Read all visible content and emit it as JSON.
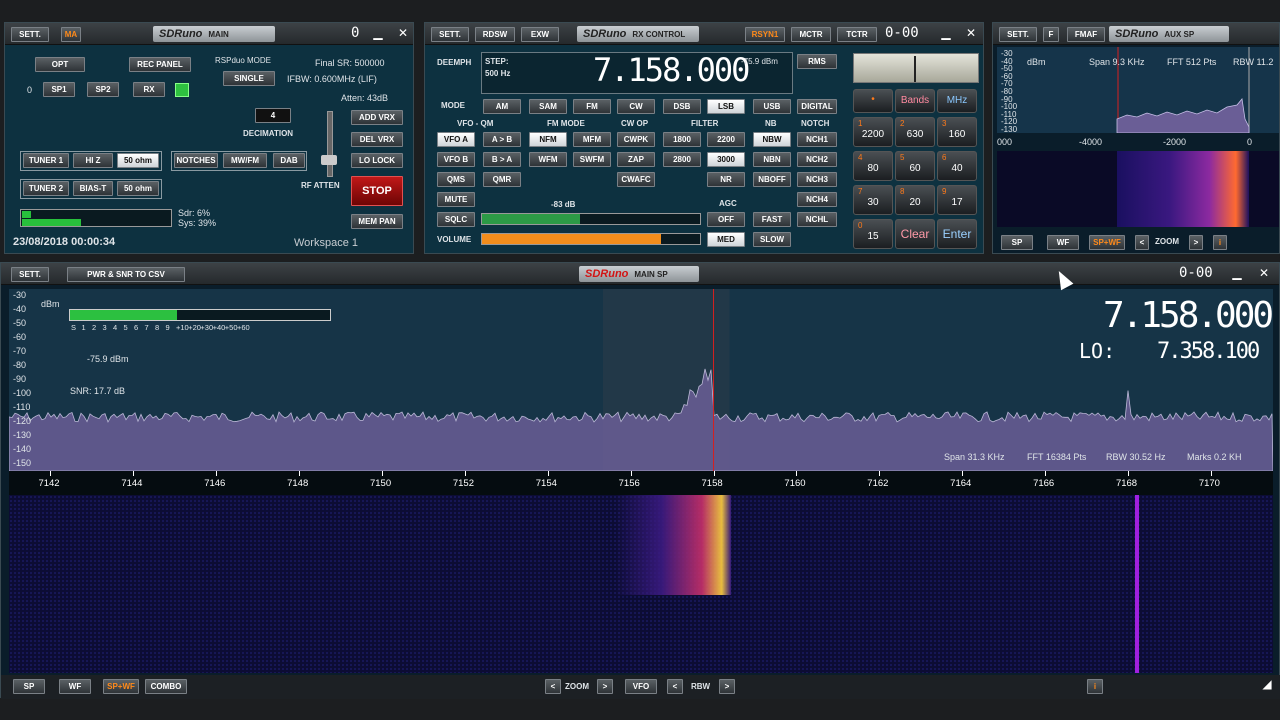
{
  "main": {
    "sett": "SETT.",
    "ma": "MA",
    "logo": "SDRuno",
    "title": "MAIN",
    "counter": "0",
    "opt": "OPT",
    "rec_panel": "REC PANEL",
    "rsp_mode_label": "RSPduo MODE",
    "single": "SINGLE",
    "final_sr": "Final SR: 500000",
    "ifbw": "IFBW: 0.600MHz (LIF)",
    "atten": "Atten: 43dB",
    "num0": "0",
    "sp1": "SP1",
    "sp2": "SP2",
    "rx": "RX",
    "decimation_val": "4",
    "decimation_label": "DECIMATION",
    "add_vrx": "ADD VRX",
    "del_vrx": "DEL VRX",
    "lo_lock": "LO LOCK",
    "rf_atten": "RF ATTEN",
    "stop": "STOP",
    "mem_pan": "MEM PAN",
    "tuner1": "TUNER 1",
    "hiz": "HI Z",
    "ohm1": "50 ohm",
    "notches": "NOTCHES",
    "mwfm": "MW/FM",
    "dab": "DAB",
    "tuner2": "TUNER 2",
    "biast": "BIAS-T",
    "ohm2": "50 ohm",
    "sdr": "Sdr: 6%",
    "sys": "Sys: 39%",
    "sdr_load": 0.06,
    "sys_load": 0.39,
    "datetime": "23/08/2018 00:00:34",
    "workspace": "Workspace 1"
  },
  "rx": {
    "sett": "SETT.",
    "rdsw": "RDSW",
    "exw": "EXW",
    "logo": "SDRuno",
    "title": "RX CONTROL",
    "rsyn": "RSYN1",
    "mctr": "MCTR",
    "tctr": "TCTR",
    "counter": "0-00",
    "deemph": "DEEMPH",
    "step": "STEP:",
    "step_val": "500 Hz",
    "freq": "7.158.000",
    "dbm": "-75.9 dBm",
    "rms": "RMS",
    "mode": "MODE",
    "modes": [
      "AM",
      "SAM",
      "FM",
      "CW",
      "DSB",
      "LSB",
      "USB",
      "DIGITAL"
    ],
    "vfo_qm": "VFO - QM",
    "fm_mode": "FM MODE",
    "cw_op": "CW OP",
    "filter": "FILTER",
    "nb": "NB",
    "notch": "NOTCH",
    "vfoa": "VFO A",
    "ab": "A > B",
    "nfm": "NFM",
    "mfm": "MFM",
    "cwpk": "CWPK",
    "f1800": "1800",
    "f2200": "2200",
    "nbw": "NBW",
    "nch1": "NCH1",
    "vfob": "VFO B",
    "ba": "B > A",
    "wfm": "WFM",
    "swfm": "SWFM",
    "zap": "ZAP",
    "f2800": "2800",
    "f3000": "3000",
    "nbn": "NBN",
    "nch2": "NCH2",
    "qms": "QMS",
    "qmr": "QMR",
    "cwafc": "CWAFC",
    "nr": "NR",
    "nboff": "NBOFF",
    "nch3": "NCH3",
    "mute": "MUTE",
    "sq_db": "-83 dB",
    "agc": "AGC",
    "nch4": "NCH4",
    "sqlc": "SQLC",
    "off": "OFF",
    "fast": "FAST",
    "nchl": "NCHL",
    "sql_level": 0.45,
    "volume": "VOLUME",
    "med": "MED",
    "slow": "SLOW",
    "volume_level": 0.82
  },
  "keypad": {
    "bands": "Bands",
    "mhz": "MHz",
    "clear": "Clear",
    "enter": "Enter",
    "keys": [
      {
        "s": "1",
        "m": "2200"
      },
      {
        "s": "2",
        "m": "630"
      },
      {
        "s": "3",
        "m": "160"
      },
      {
        "s": "4",
        "m": "80"
      },
      {
        "s": "5",
        "m": "60"
      },
      {
        "s": "6",
        "m": "40"
      },
      {
        "s": "7",
        "m": "30"
      },
      {
        "s": "8",
        "m": "20"
      },
      {
        "s": "9",
        "m": "17"
      },
      {
        "s": "0",
        "m": "15"
      }
    ]
  },
  "aux": {
    "sett": "SETT.",
    "f": "F",
    "fmaf": "FMAF",
    "logo": "SDRuno",
    "title": "AUX SP",
    "dbm": "dBm",
    "span": "Span 9.3 KHz",
    "fft": "FFT 512 Pts",
    "rbw": "RBW 11.2",
    "y": [
      "-30",
      "-40",
      "-50",
      "-60",
      "-70",
      "-80",
      "-90",
      "-100",
      "-110",
      "-120",
      "-130"
    ],
    "x": [
      "000",
      "-4000",
      "-2000",
      "0"
    ],
    "sp": "SP",
    "wf": "WF",
    "spwf": "SP+WF",
    "zoom": "ZOOM",
    "info": "i"
  },
  "sp": {
    "sett": "SETT.",
    "csv": "PWR & SNR TO CSV",
    "logo": "SDRuno",
    "title": "MAIN SP",
    "counter": "0-00",
    "dbm": "dBm",
    "smeter_scale": [
      "S",
      "1",
      "2",
      "3",
      "4",
      "5",
      "6",
      "7",
      "8",
      "9",
      "+10",
      "+20",
      "+30",
      "+40",
      "+50",
      "+60"
    ],
    "smeter_level": 0.41,
    "level": "-75.9 dBm",
    "snr": "SNR: 17.7 dB",
    "freq": "7.158.000",
    "lo_label": "LO:",
    "lo": "7.358.100",
    "span": "Span 31.3 KHz",
    "fft": "FFT 16384 Pts",
    "rbw": "RBW 30.52 Hz",
    "marks": "Marks 0.2 KH",
    "y": [
      "-30",
      "-40",
      "-50",
      "-60",
      "-70",
      "-80",
      "-90",
      "-100",
      "-110",
      "-120",
      "-130",
      "-140",
      "-150"
    ],
    "x": [
      "7142",
      "7144",
      "7146",
      "7148",
      "7150",
      "7152",
      "7154",
      "7156",
      "7158",
      "7160",
      "7162",
      "7164",
      "7166",
      "7168",
      "7170"
    ],
    "tuned_khz": 7158,
    "x_min_khz": 7141,
    "x_max_khz": 7171.5,
    "bottom": {
      "sp": "SP",
      "wf": "WF",
      "spwf": "SP+WF",
      "combo": "COMBO",
      "zoom": "ZOOM",
      "vfo": "VFO",
      "rbw": "RBW",
      "prev": "<",
      "next": ">",
      "info": "i"
    }
  },
  "colors": {
    "accent": "#ff8a1a",
    "panel": "#0d3140",
    "spectrum": "#6a5e96",
    "waterfall": "#101040",
    "marker": "#d62020"
  }
}
